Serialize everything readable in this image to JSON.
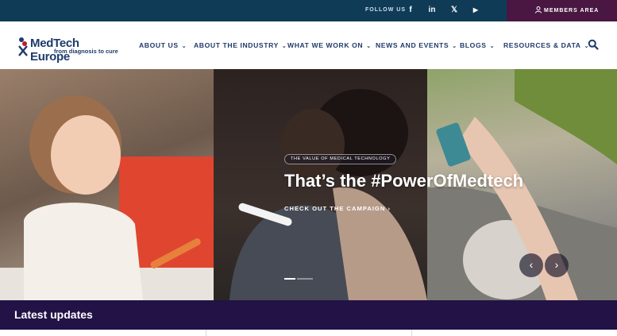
{
  "topbar": {
    "follow_label": "FOLLOW US",
    "social": [
      {
        "name": "facebook",
        "glyph": "f"
      },
      {
        "name": "linkedin",
        "glyph": "in"
      },
      {
        "name": "x",
        "glyph": "𝕏"
      },
      {
        "name": "youtube",
        "glyph": "▶"
      }
    ],
    "members_label": "MEMBERS AREA"
  },
  "logo": {
    "name": "MedTech Europe",
    "tagline": "from diagnosis to cure"
  },
  "nav": {
    "items": [
      {
        "label": "ABOUT US"
      },
      {
        "label": "ABOUT THE INDUSTRY"
      },
      {
        "label": "WHAT WE WORK ON"
      },
      {
        "label": "NEWS AND EVENTS"
      },
      {
        "label": "BLOGS"
      },
      {
        "label": "RESOURCES & DATA"
      }
    ]
  },
  "hero": {
    "badge": "THE VALUE OF MEDICAL TECHNOLOGY",
    "title": "That’s the #PowerOfMedtech",
    "link": "CHECK OUT THE CAMPAIGN",
    "slides_count": 2,
    "active_slide": 1,
    "prev_glyph": "‹",
    "next_glyph": "›"
  },
  "latest": {
    "title": "Latest updates"
  },
  "colors": {
    "topbar": "#0f3b57",
    "members": "#4a1642",
    "brand": "#1f3a6b",
    "latest": "#221246"
  }
}
